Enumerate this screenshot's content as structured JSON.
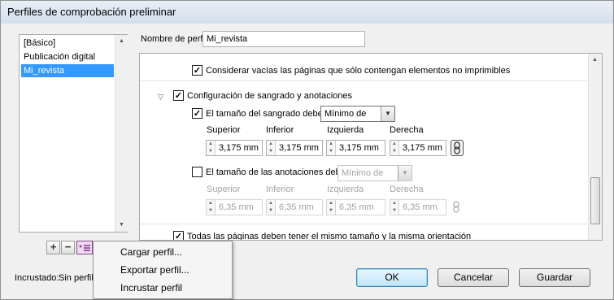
{
  "window": {
    "title": "Perfiles de comprobación preliminar"
  },
  "profiles": {
    "items": [
      "[Básico]",
      "Publicación digital",
      "Mi_revista"
    ],
    "selected_index": 2
  },
  "profile_name": {
    "label": "Nombre de perfil:",
    "value": "Mi_revista"
  },
  "settings": {
    "empty_pages_label": "Considerar vacías las páginas que sólo contengan elementos no imprimibles",
    "bleed_section_label": "Configuración de sangrado y anotaciones",
    "bleed": {
      "label": "El tamaño del sangrado debe ser:",
      "option": "Mínimo de",
      "headers": [
        "Superior",
        "Inferior",
        "Izquierda",
        "Derecha"
      ],
      "values": [
        "3,175 mm",
        "3,175 mm",
        "3,175 mm",
        "3,175 mm"
      ]
    },
    "slug": {
      "label": "El tamaño de las anotaciones debe ser:",
      "option": "Mínimo de",
      "headers": [
        "Superior",
        "Inferior",
        "Izquierda",
        "Derecha"
      ],
      "values": [
        "6,35 mm",
        "6,35 mm",
        "6,35 mm",
        "6,35 mm"
      ]
    },
    "same_size_label": "Todas las páginas deben tener el mismo tamaño y la misma orientación"
  },
  "embedded": {
    "label": "Incrustado:",
    "value": "Sin perfil i"
  },
  "buttons": {
    "ok": "OK",
    "cancel": "Cancelar",
    "save": "Guardar"
  },
  "menu": {
    "items": [
      "Cargar perfil...",
      "Exportar perfil...",
      "Incrustar perfil"
    ]
  },
  "icons": {
    "add": "plus-icon",
    "remove": "minus-icon",
    "menu": "profile-menu-icon",
    "expand": "triangle-down-icon",
    "link": "chain-link-icon"
  }
}
